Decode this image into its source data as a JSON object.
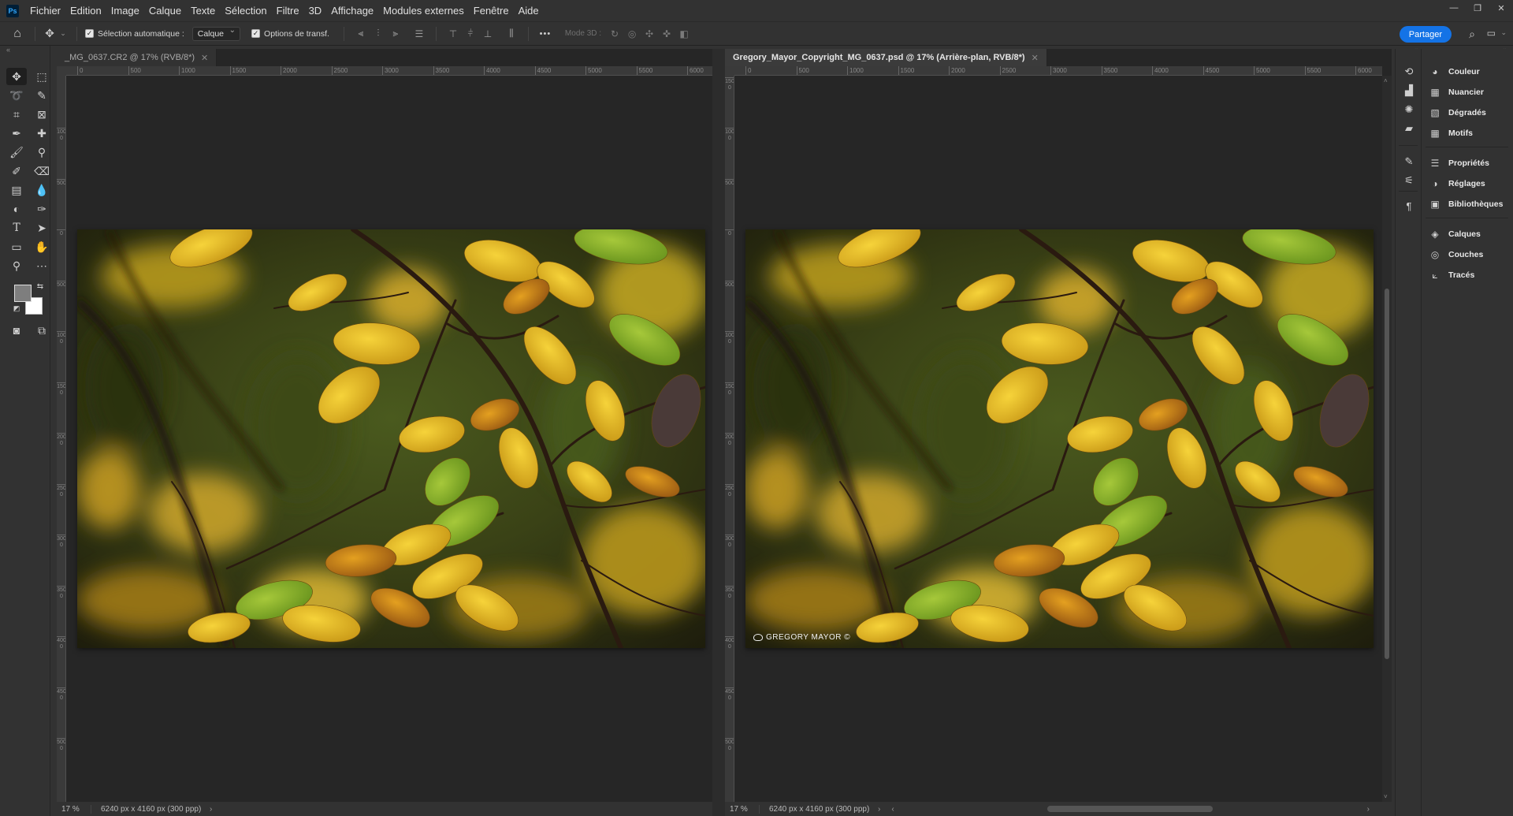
{
  "app": {
    "logo": "Ps"
  },
  "menu": [
    "Fichier",
    "Edition",
    "Image",
    "Calque",
    "Texte",
    "Sélection",
    "Filtre",
    "3D",
    "Affichage",
    "Modules externes",
    "Fenêtre",
    "Aide"
  ],
  "window_controls": {
    "minimize": "—",
    "maximize": "❐",
    "close": "✕"
  },
  "options": {
    "auto_select_label": "Sélection automatique :",
    "auto_select_value": "Calque",
    "transform_label": "Options de transf.",
    "more": "•••",
    "mode3d_label": "Mode 3D :"
  },
  "share_label": "Partager",
  "docs": [
    {
      "tab_label": "_MG_0637.CR2 @ 17% (RVB/8*)",
      "active": false,
      "zoom": "17 %",
      "dims": "6240 px x 4160 px (300 ppp)",
      "ruler_h": [
        "0",
        "500",
        "1000",
        "1500",
        "2000",
        "2500",
        "3000",
        "3500",
        "4000",
        "4500",
        "5000",
        "5500",
        "6000"
      ],
      "ruler_v": [
        "1000",
        "500",
        "0",
        "500",
        "1000",
        "1500",
        "2000",
        "2500",
        "3000",
        "3500",
        "4000",
        "4500",
        "5000"
      ]
    },
    {
      "tab_label": "Gregory_Mayor_Copyright_MG_0637.psd @ 17% (Arrière-plan, RVB/8*)",
      "active": true,
      "zoom": "17 %",
      "dims": "6240 px x 4160 px (300 ppp)",
      "ruler_h": [
        "0",
        "500",
        "1000",
        "1500",
        "2000",
        "2500",
        "3000",
        "3500",
        "4000",
        "4500",
        "5000",
        "5500",
        "6000"
      ],
      "ruler_v": [
        "1500",
        "1000",
        "500",
        "0",
        "500",
        "1000",
        "1500",
        "2000",
        "2500",
        "3000",
        "3500",
        "4000",
        "4500",
        "5000"
      ],
      "watermark": "GREGORY MAYOR ©"
    }
  ],
  "panels": [
    {
      "label": "Couleur",
      "icon": "color-wheel-icon",
      "glyph": "◕"
    },
    {
      "label": "Nuancier",
      "icon": "swatches-icon",
      "glyph": "▦"
    },
    {
      "label": "Dégradés",
      "icon": "gradient-icon",
      "glyph": "▧"
    },
    {
      "label": "Motifs",
      "icon": "patterns-icon",
      "glyph": "▦"
    },
    {
      "label": "Propriétés",
      "icon": "properties-icon",
      "glyph": "☰"
    },
    {
      "label": "Réglages",
      "icon": "adjustments-icon",
      "glyph": "◑"
    },
    {
      "label": "Bibliothèques",
      "icon": "libraries-icon",
      "glyph": "▣"
    },
    {
      "label": "Calques",
      "icon": "layers-icon",
      "glyph": "◈"
    },
    {
      "label": "Couches",
      "icon": "channels-icon",
      "glyph": "◎"
    },
    {
      "label": "Tracés",
      "icon": "paths-icon",
      "glyph": "⟀"
    }
  ]
}
